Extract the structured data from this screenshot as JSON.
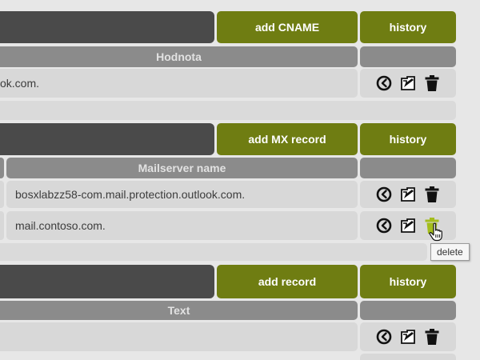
{
  "section1": {
    "add_label": "add CNAME",
    "history_label": "history",
    "column_header": "Hodnota",
    "rows": [
      {
        "value": "ok.com."
      }
    ]
  },
  "section2": {
    "add_label": "add MX record",
    "history_label": "history",
    "column_header": "Mailserver name",
    "rows": [
      {
        "value": "bosxlabzz58-com.mail.protection.outlook.com."
      },
      {
        "value": "mail.contoso.com."
      }
    ]
  },
  "section3": {
    "add_label": "add record",
    "history_label": "history",
    "column_header": "Text",
    "rows": [
      {
        "value": ""
      }
    ]
  },
  "tooltip": {
    "text": "delete"
  },
  "icons": {
    "history": "history-clock-icon",
    "edit": "edit-icon",
    "delete": "trash-icon"
  },
  "colors": {
    "accent_green": "#6f7d12",
    "delete_hover": "#a4bd1c",
    "dark_bar": "#4a4a4a",
    "header_gray": "#8b8b8b",
    "cell_gray": "#d8d8d8"
  }
}
